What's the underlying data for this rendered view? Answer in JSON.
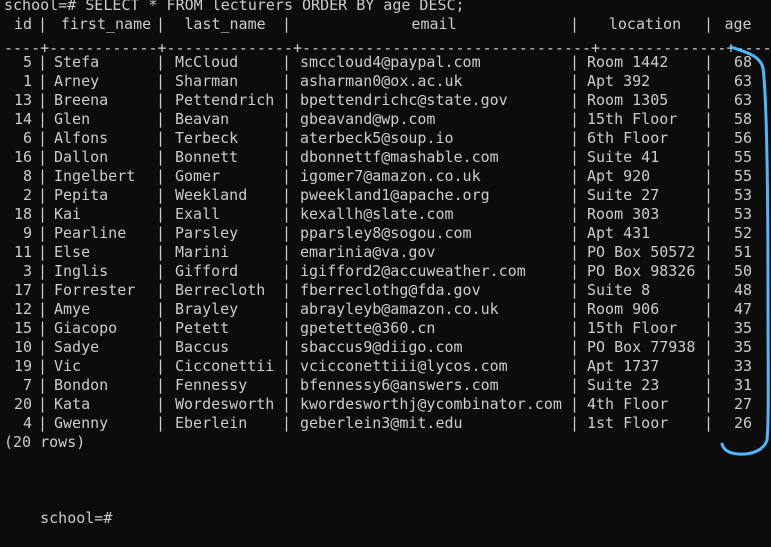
{
  "terminal": {
    "command_line": "school=# SELECT * FROM lecturers ORDER BY age DESC;",
    "row_count": "(20 rows)",
    "prompt": "school=#",
    "divider": "----+------------+--------------+--------------------------------+--------------+-----",
    "annotation_color": "#4db8ff"
  },
  "table": {
    "columns": [
      "id",
      "first_name",
      "last_name",
      "email",
      "location",
      "age"
    ],
    "rows": [
      {
        "id": "5",
        "first_name": "Stefa",
        "last_name": "McCloud",
        "email": "smccloud4@paypal.com",
        "location": "Room 1442",
        "age": "68"
      },
      {
        "id": "1",
        "first_name": "Arney",
        "last_name": "Sharman",
        "email": "asharman0@ox.ac.uk",
        "location": "Apt 392",
        "age": "63"
      },
      {
        "id": "13",
        "first_name": "Breena",
        "last_name": "Pettendrich",
        "email": "bpettendrichc@state.gov",
        "location": "Room 1305",
        "age": "63"
      },
      {
        "id": "14",
        "first_name": "Glen",
        "last_name": "Beavan",
        "email": "gbeavand@wp.com",
        "location": "15th Floor",
        "age": "58"
      },
      {
        "id": "6",
        "first_name": "Alfons",
        "last_name": "Terbeck",
        "email": "aterbeck5@soup.io",
        "location": "6th Floor",
        "age": "56"
      },
      {
        "id": "16",
        "first_name": "Dallon",
        "last_name": "Bonnett",
        "email": "dbonnettf@mashable.com",
        "location": "Suite 41",
        "age": "55"
      },
      {
        "id": "8",
        "first_name": "Ingelbert",
        "last_name": "Gomer",
        "email": "igomer7@amazon.co.uk",
        "location": "Apt 920",
        "age": "55"
      },
      {
        "id": "2",
        "first_name": "Pepita",
        "last_name": "Weekland",
        "email": "pweekland1@apache.org",
        "location": "Suite 27",
        "age": "53"
      },
      {
        "id": "18",
        "first_name": "Kai",
        "last_name": "Exall",
        "email": "kexallh@slate.com",
        "location": "Room 303",
        "age": "53"
      },
      {
        "id": "9",
        "first_name": "Pearline",
        "last_name": "Parsley",
        "email": "pparsley8@sogou.com",
        "location": "Apt 431",
        "age": "52"
      },
      {
        "id": "11",
        "first_name": "Else",
        "last_name": "Marini",
        "email": "emarinia@va.gov",
        "location": "PO Box 50572",
        "age": "51"
      },
      {
        "id": "3",
        "first_name": "Inglis",
        "last_name": "Gifford",
        "email": "igifford2@accuweather.com",
        "location": "PO Box 98326",
        "age": "50"
      },
      {
        "id": "17",
        "first_name": "Forrester",
        "last_name": "Berrecloth",
        "email": "fberreclothg@fda.gov",
        "location": "Suite 8",
        "age": "48"
      },
      {
        "id": "12",
        "first_name": "Amye",
        "last_name": "Brayley",
        "email": "abrayleyb@amazon.co.uk",
        "location": "Room 906",
        "age": "47"
      },
      {
        "id": "15",
        "first_name": "Giacopo",
        "last_name": "Petett",
        "email": "gpetette@360.cn",
        "location": "15th Floor",
        "age": "35"
      },
      {
        "id": "10",
        "first_name": "Sadye",
        "last_name": "Baccus",
        "email": "sbaccus9@diigo.com",
        "location": "PO Box 77938",
        "age": "35"
      },
      {
        "id": "19",
        "first_name": "Vic",
        "last_name": "Cicconettii",
        "email": "vcicconettiii@lycos.com",
        "location": "Apt 1737",
        "age": "33"
      },
      {
        "id": "7",
        "first_name": "Bondon",
        "last_name": "Fennessy",
        "email": "bfennessy6@answers.com",
        "location": "Suite 23",
        "age": "31"
      },
      {
        "id": "20",
        "first_name": "Kata",
        "last_name": "Wordesworth",
        "email": "kwordesworthj@ycombinator.com",
        "location": "4th Floor",
        "age": "27"
      },
      {
        "id": "4",
        "first_name": "Gwenny",
        "last_name": "Eberlein",
        "email": "geberlein3@mit.edu",
        "location": "1st Floor",
        "age": "26"
      }
    ]
  }
}
